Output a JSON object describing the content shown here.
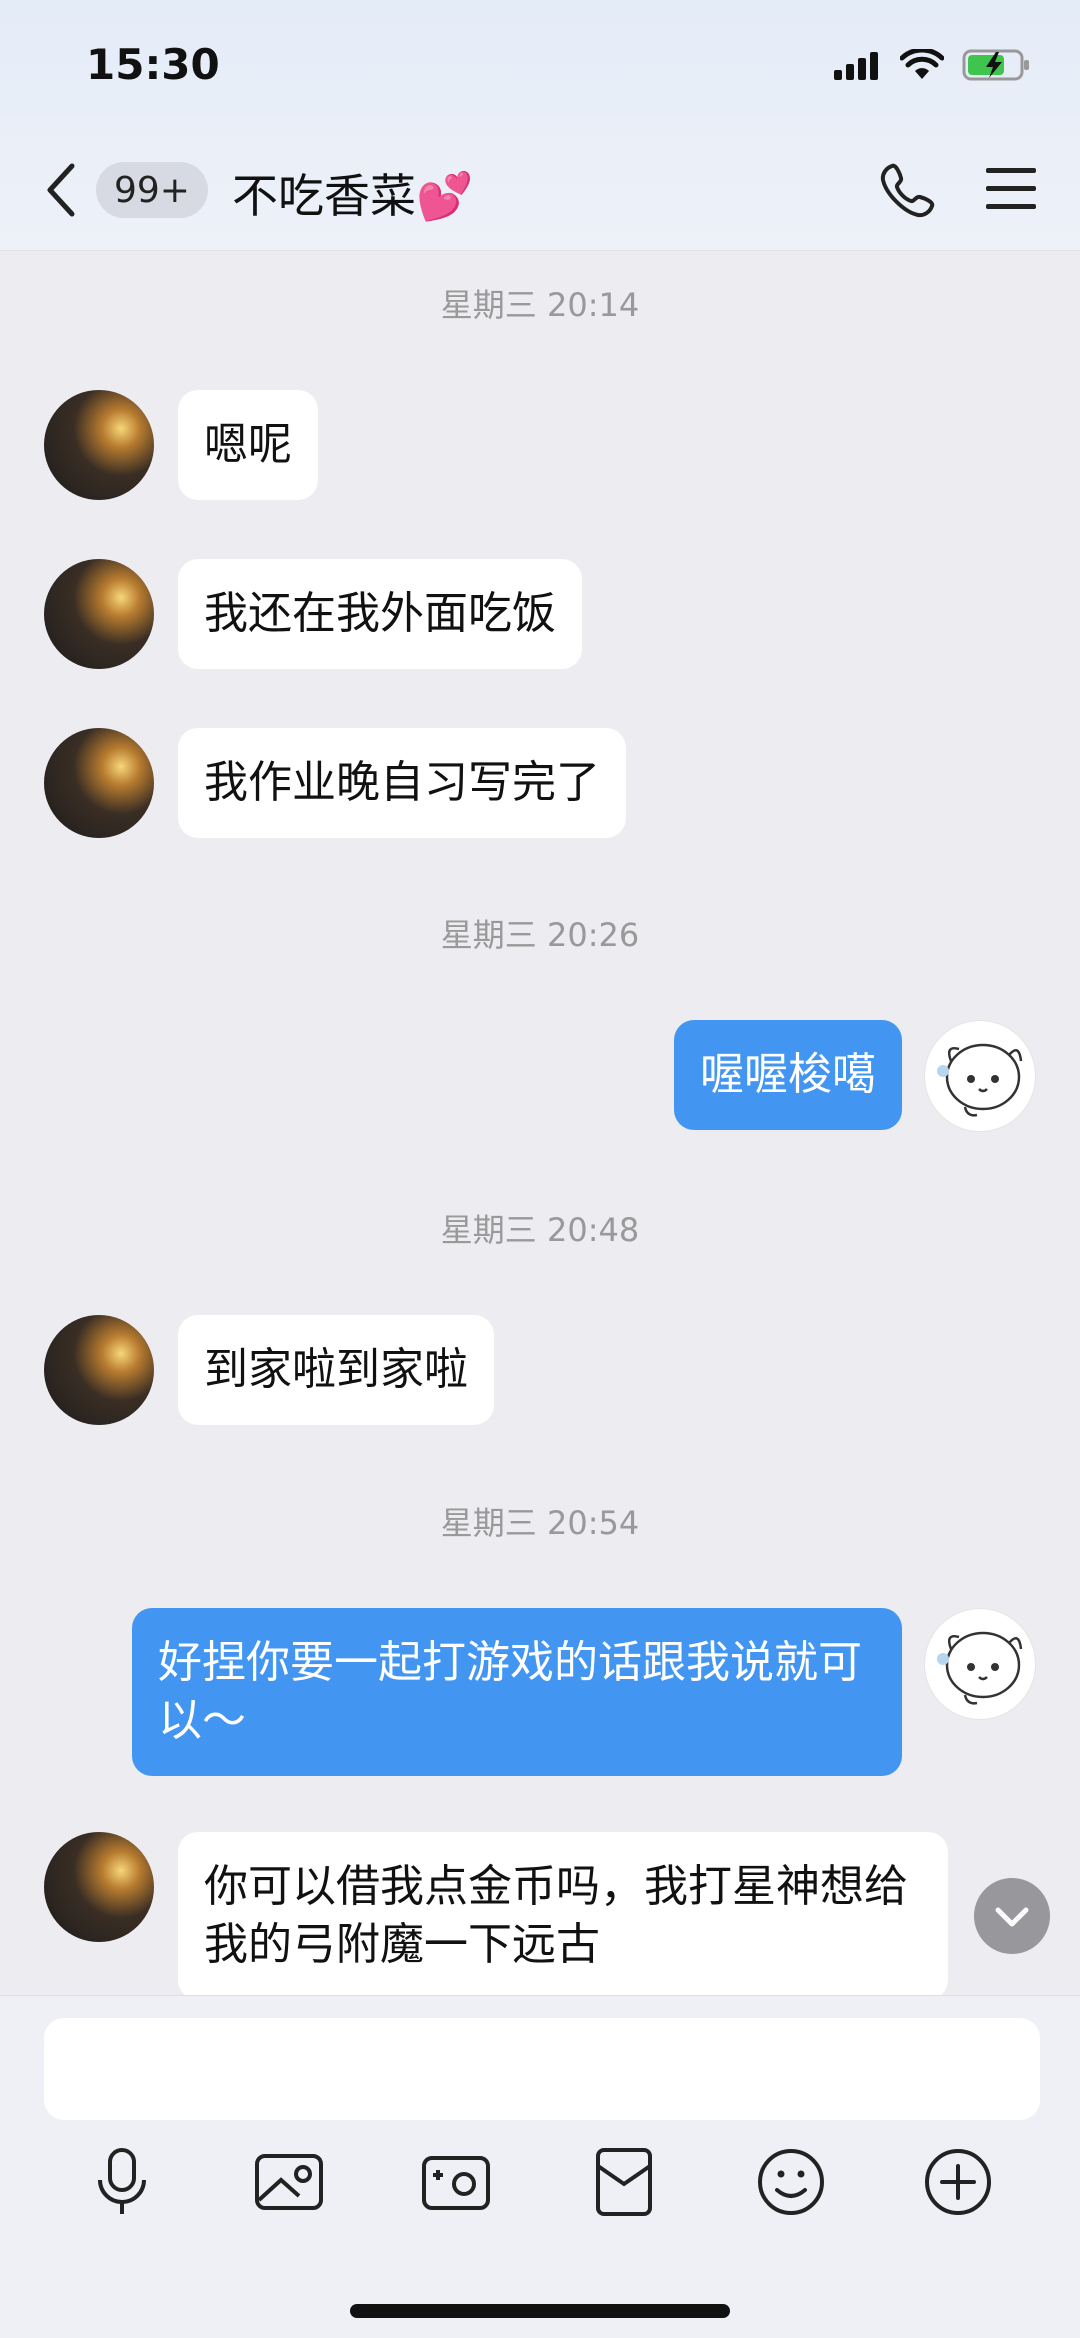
{
  "status_bar": {
    "time": "15:30"
  },
  "header": {
    "unread_badge": "99+",
    "title": "不吃香菜💕"
  },
  "messages": [
    {
      "type": "time",
      "text": "星期三 20:14"
    },
    {
      "type": "in",
      "text": "嗯呢"
    },
    {
      "type": "in",
      "text": "我还在我外面吃饭"
    },
    {
      "type": "in",
      "text": "我作业晚自习写完了"
    },
    {
      "type": "time",
      "text": "星期三 20:26"
    },
    {
      "type": "out",
      "text": "喔喔梭噶"
    },
    {
      "type": "time",
      "text": "星期三 20:48"
    },
    {
      "type": "in",
      "text": "到家啦到家啦"
    },
    {
      "type": "time",
      "text": "星期三 20:54"
    },
    {
      "type": "out",
      "text": "好捏你要一起打游戏的话跟我说就可以～"
    },
    {
      "type": "in",
      "text": "你可以借我点金币吗，我打星神想给我的弓附魔一下远古"
    }
  ],
  "input": {
    "placeholder": ""
  },
  "toolbar": {
    "items": [
      "microphone-icon",
      "photo-icon",
      "camera-icon",
      "red-packet-icon",
      "emoji-icon",
      "plus-icon"
    ]
  },
  "colors": {
    "accent": "#4395f2",
    "background": "#ececf1"
  }
}
